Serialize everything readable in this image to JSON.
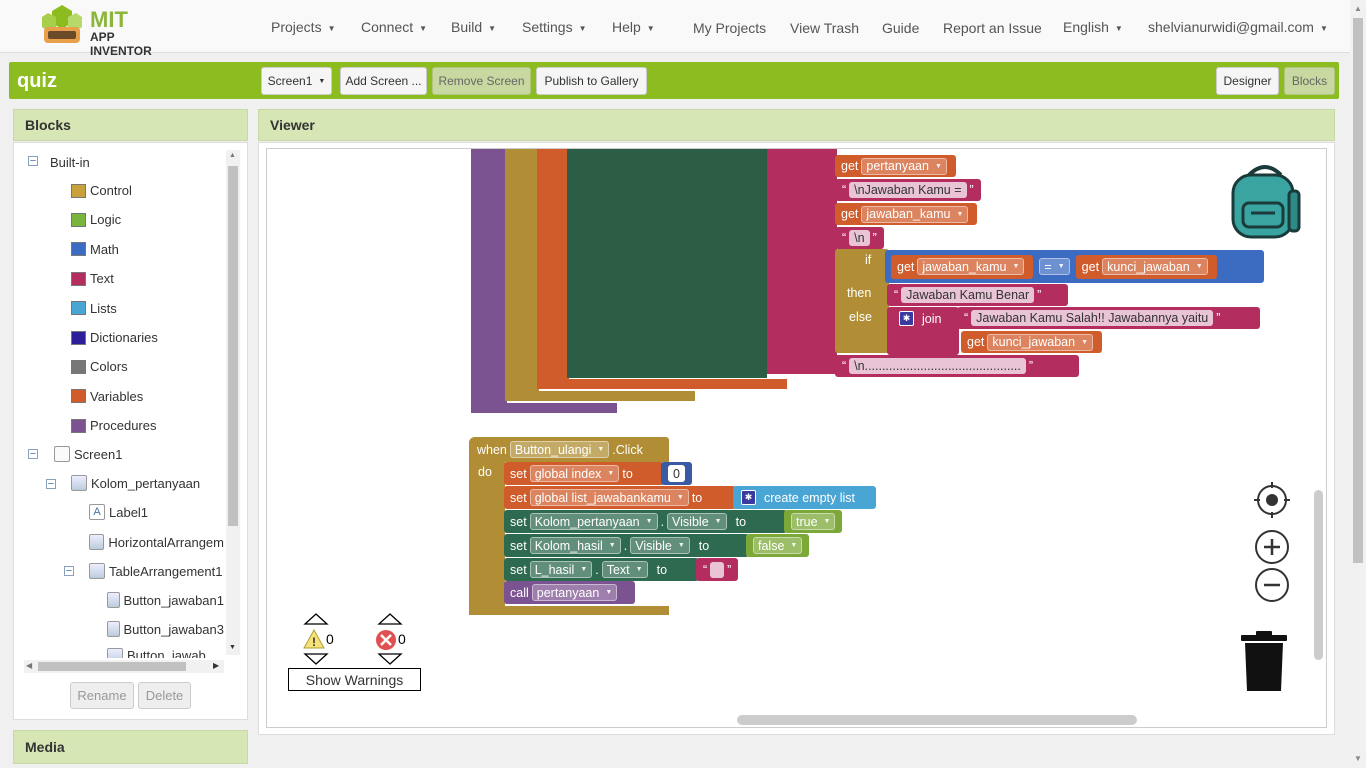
{
  "header": {
    "logo_mit": "MIT",
    "logo_sub": "APP INVENTOR",
    "menus": [
      "Projects",
      "Connect",
      "Build",
      "Settings",
      "Help"
    ],
    "links": [
      "My Projects",
      "View Trash",
      "Guide",
      "Report an Issue"
    ],
    "language": "English",
    "account": "shelvianurwidi@gmail.com"
  },
  "project": {
    "title": "quiz",
    "screen_select": "Screen1",
    "add_screen": "Add Screen ...",
    "remove_screen": "Remove Screen",
    "publish": "Publish to Gallery",
    "designer": "Designer",
    "blocks": "Blocks"
  },
  "blocks_panel": {
    "title": "Blocks",
    "builtin_label": "Built-in",
    "builtin": [
      {
        "label": "Control",
        "color": "#c8a13a"
      },
      {
        "label": "Logic",
        "color": "#79b53c"
      },
      {
        "label": "Math",
        "color": "#3c6cc1"
      },
      {
        "label": "Text",
        "color": "#b32d5e"
      },
      {
        "label": "Lists",
        "color": "#49a6d4"
      },
      {
        "label": "Dictionaries",
        "color": "#2d1f99"
      },
      {
        "label": "Colors",
        "color": "#777777"
      },
      {
        "label": "Variables",
        "color": "#d05b2b"
      },
      {
        "label": "Procedures",
        "color": "#7c5391"
      }
    ],
    "components": [
      "Screen1",
      "Kolom_pertanyaan",
      "Label1",
      "HorizontalArrangem",
      "TableArrangement1",
      "Button_jawaban1",
      "Button_jawaban3",
      "Button_jawab"
    ],
    "rename": "Rename",
    "delete": "Delete",
    "media": "Media"
  },
  "viewer": {
    "title": "Viewer",
    "top_blocks": {
      "get1": "get",
      "var_pertanyaan": "pertanyaan",
      "str_jawaban_kamu": "\\nJawaban Kamu =",
      "var_jawaban_kamu": "jawaban_kamu",
      "str_n": "\\n",
      "if": "if",
      "then": "then",
      "else": "else",
      "eq": "=",
      "var_kunci": "kunci_jawaban",
      "str_benar": "Jawaban Kamu Benar",
      "join": "join",
      "str_salah": "Jawaban Kamu Salah!! Jawabannya yaitu",
      "str_dots": "\\n.............................................",
      "q_open": "“",
      "q_close": "”"
    },
    "event": {
      "when": "when",
      "component": "Button_ulangi",
      "event": ".Click",
      "do": "do",
      "set": "set",
      "to": "to",
      "call": "call",
      "global_index": "global index",
      "zero": "0",
      "global_list": "global list_jawabankamu",
      "create_empty_list": "create empty list",
      "kolom_pertanyaan": "Kolom_pertanyaan",
      "visible": "Visible",
      "true": "true",
      "kolom_hasil": "Kolom_hasil",
      "false": "false",
      "l_hasil": "L_hasil",
      "text_prop": "Text",
      "dot": ".",
      "proc": "pertanyaan"
    },
    "warnings_count": "0",
    "errors_count": "0",
    "show_warnings": "Show Warnings"
  }
}
